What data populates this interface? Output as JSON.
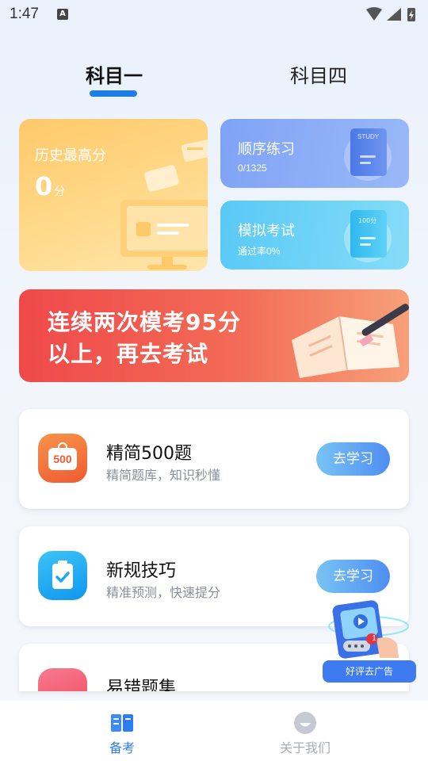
{
  "status": {
    "time": "1:47",
    "a_icon": "A"
  },
  "tabs": [
    {
      "label": "科目一",
      "active": true
    },
    {
      "label": "科目四",
      "active": false
    }
  ],
  "cards": {
    "history": {
      "title": "历史最高分",
      "score": "0",
      "unit": "分"
    },
    "order": {
      "title": "顺序练习",
      "sub": "0/1325",
      "book_label": "STUDY"
    },
    "exam": {
      "title": "模拟考试",
      "sub": "通过率0%",
      "book_label": "100分"
    }
  },
  "banner": {
    "line1": "连续两次模考95分",
    "line2": "以上，再去考试"
  },
  "list": [
    {
      "title": "精简500题",
      "sub": "精简题库，知识秒懂",
      "button": "去学习",
      "badge": "500",
      "icon": "500-questions-icon",
      "color": "#f26a3a"
    },
    {
      "title": "新规技巧",
      "sub": "精准预测，快速提分",
      "button": "去学习",
      "icon": "clipboard-check-icon",
      "color": "#1aa8f2"
    },
    {
      "title": "易错题集",
      "icon": "error-set-icon",
      "color": "#f2546a"
    }
  ],
  "float_ad": {
    "label": "好评去广告",
    "badge": "1"
  },
  "nav": [
    {
      "label": "备考",
      "icon": "book-icon",
      "active": true
    },
    {
      "label": "关于我们",
      "icon": "smile-face-icon",
      "active": false
    }
  ],
  "colors": {
    "accent": "#2b7df2",
    "underline": "#1d7ee8",
    "inactive": "#a8adb6"
  }
}
